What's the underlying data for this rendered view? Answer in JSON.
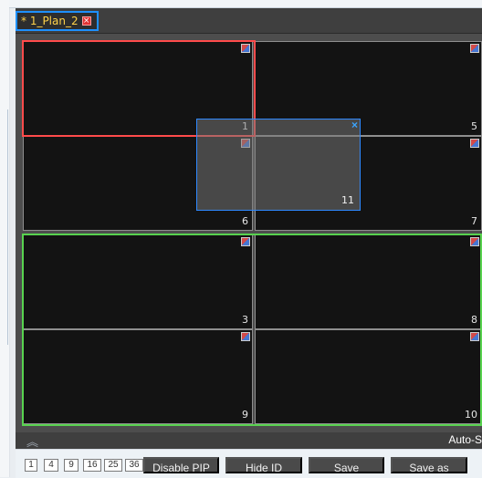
{
  "tab": {
    "title": "* 1_Plan_2",
    "close_glyph": "×"
  },
  "pip": {
    "number": "11",
    "close_glyph": "×"
  },
  "cells": [
    {
      "number": "1"
    },
    {
      "number": "5"
    },
    {
      "number": "6"
    },
    {
      "number": "7"
    },
    {
      "number": "3"
    },
    {
      "number": "8"
    },
    {
      "number": "9"
    },
    {
      "number": "10"
    }
  ],
  "auto_bar": {
    "label": "Auto-S",
    "chevron": "︽"
  },
  "layout_buttons": [
    "1",
    "4",
    "9",
    "16",
    "25",
    "36"
  ],
  "actions": {
    "disable_pip": "Disable PIP",
    "hide_id": "Hide ID",
    "save": "Save",
    "save_as": "Save as"
  }
}
